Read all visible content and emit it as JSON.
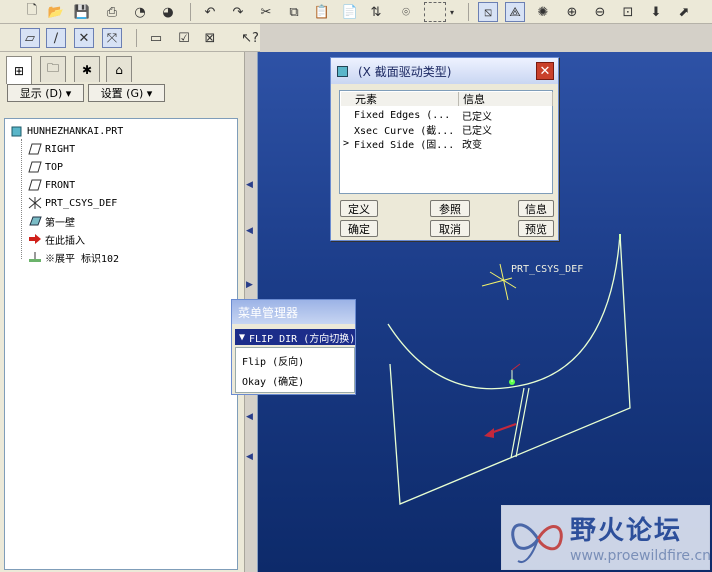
{
  "toolbar": {
    "icons": [
      "new-file-icon",
      "open-folder-icon",
      "save-icon",
      "print-icon",
      "headphones-icon",
      "headphones2-icon",
      "undo-icon",
      "redo-icon",
      "cut-icon",
      "copy-icon",
      "paste-icon",
      "paste-special-icon",
      "regenerate-icon",
      "binoculars-icon",
      "select-box-icon",
      "dropdown-icon",
      "sketch-icon",
      "datum-display-icon",
      "spin-icon",
      "zoom-in-icon",
      "zoom-out-icon",
      "refit-icon",
      "orient-icon",
      "view-icon"
    ]
  },
  "tabs": {
    "icons": [
      "model-tree-icon",
      "folder-browser-icon",
      "favorites-icon",
      "connections-icon"
    ]
  },
  "panel": {
    "display_label": "显示 (D) ▾",
    "settings_label": "设置 (G) ▾"
  },
  "tree": {
    "root": "HUNHEZHANKAI.PRT",
    "items": [
      "RIGHT",
      "TOP",
      "FRONT",
      "PRT_CSYS_DEF",
      "第一壁",
      "在此插入",
      "※展平 标识102"
    ]
  },
  "dialog": {
    "title": "(X 截面驱动类型)",
    "col_element": "元素",
    "col_info": "信息",
    "rows": [
      {
        "element": "Fixed Edges (...",
        "info": "已定义",
        "marker": ""
      },
      {
        "element": "Xsec Curve (截...",
        "info": "已定义",
        "marker": ""
      },
      {
        "element": "Fixed Side (固...",
        "info": "改变",
        "marker": ">"
      }
    ],
    "buttons": {
      "define": "定义",
      "reference": "参照",
      "info": "信息",
      "ok": "确定",
      "cancel": "取消",
      "preview": "预览"
    }
  },
  "menu_manager": {
    "title": "菜单管理器",
    "header": "FLIP DIR (方向切换)",
    "items": [
      "Flip (反向)",
      "Okay (确定)"
    ]
  },
  "model": {
    "csys_label": "PRT_CSYS_DEF"
  },
  "watermark": {
    "title": "野火论坛",
    "url": "www.proewildfire.cn"
  },
  "colors": {
    "background_top": "#2e52a6",
    "background_bottom": "#0d2a6a",
    "geometry": "#e8ffd2",
    "highlight": "#a4ff7a",
    "arrow": "#c4283c",
    "menu_header": "#1c2d8a"
  }
}
